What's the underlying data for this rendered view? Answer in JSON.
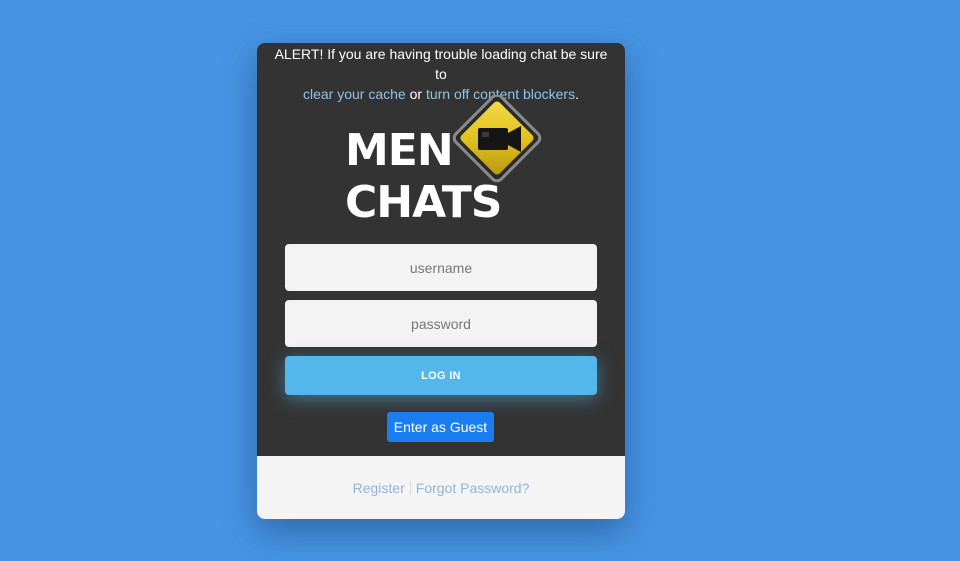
{
  "alert": {
    "prefix": "ALERT! If you are having trouble loading chat be sure to",
    "link_cache": "clear your cache",
    "middle": " or ",
    "link_blockers": "turn off content blockers",
    "suffix": "."
  },
  "logo": {
    "line1": "MEN",
    "line2": "CHATS",
    "sign_color": "#e2c21e"
  },
  "form": {
    "username_placeholder": "username",
    "password_placeholder": "password",
    "login_label": "LOG IN",
    "guest_label": "Enter as Guest"
  },
  "footer": {
    "register": "Register",
    "forgot": "Forgot Password?"
  }
}
